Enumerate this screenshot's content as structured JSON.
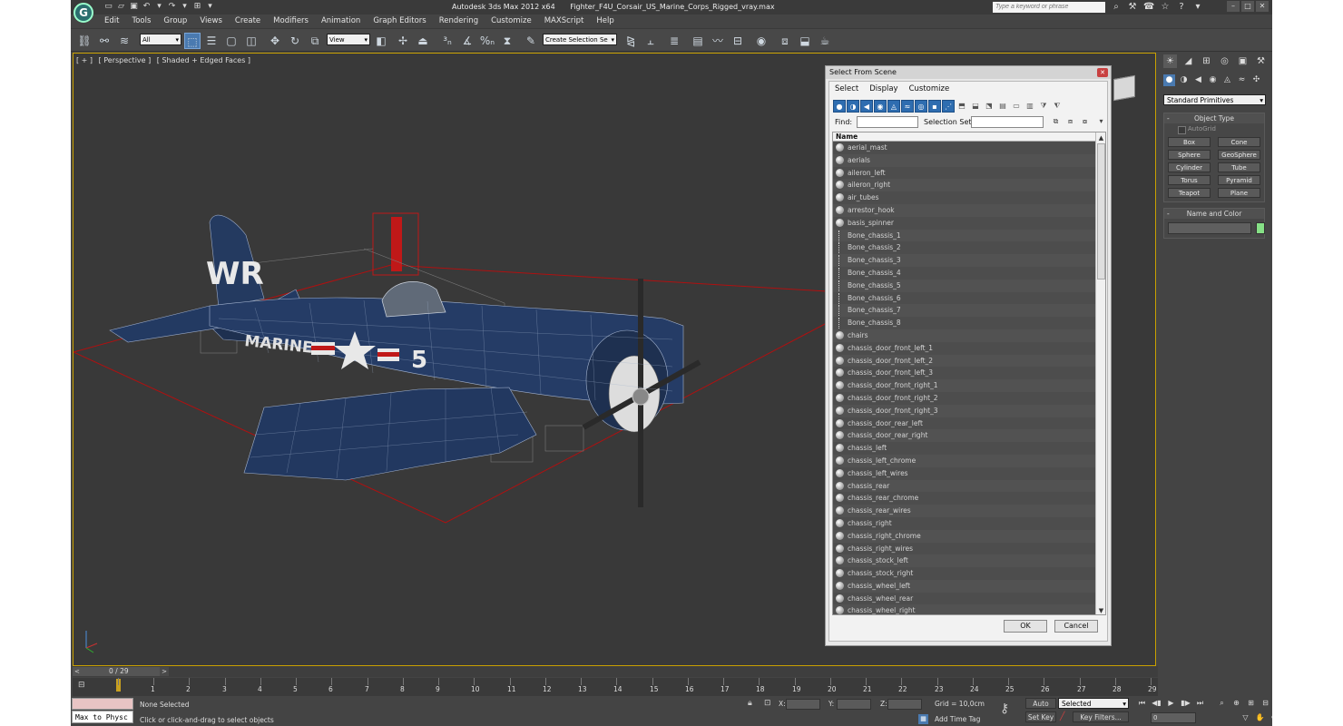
{
  "window": {
    "app_title": "Autodesk 3ds Max  2012 x64",
    "file_name": "Fighter_F4U_Corsair_US_Marine_Corps_Rigged_vray.max",
    "search_placeholder": "Type a keyword or phrase"
  },
  "menu": [
    "Edit",
    "Tools",
    "Group",
    "Views",
    "Create",
    "Modifiers",
    "Animation",
    "Graph Editors",
    "Rendering",
    "Customize",
    "MAXScript",
    "Help"
  ],
  "toolbar": {
    "selection_filter": "All",
    "reference_coord": "View",
    "named_selection_set": "Create Selection Se"
  },
  "viewport": {
    "labels": [
      "[ + ]",
      "[ Perspective ]",
      "[ Shaded + Edged Faces ]"
    ],
    "decal_text": [
      "WR",
      "MARINES",
      "5"
    ]
  },
  "command_panel": {
    "category": "Standard Primitives",
    "object_type_title": "Object Type",
    "autogrid_label": "AutoGrid",
    "primitives": [
      "Box",
      "Cone",
      "Sphere",
      "GeoSphere",
      "Cylinder",
      "Tube",
      "Torus",
      "Pyramid",
      "Teapot",
      "Plane"
    ],
    "name_color_title": "Name and Color",
    "object_color": "#86e086"
  },
  "dialog": {
    "title": "Select From Scene",
    "menu": [
      "Select",
      "Display",
      "Customize"
    ],
    "find_label": "Find:",
    "selection_set_label": "Selection Set:",
    "column_header": "Name",
    "items": [
      {
        "name": "aerial_mast",
        "kind": "geometry"
      },
      {
        "name": "aerials",
        "kind": "geometry"
      },
      {
        "name": "aileron_left",
        "kind": "geometry"
      },
      {
        "name": "aileron_right",
        "kind": "geometry"
      },
      {
        "name": "air_tubes",
        "kind": "geometry"
      },
      {
        "name": "arrestor_hook",
        "kind": "geometry"
      },
      {
        "name": "basis_spinner",
        "kind": "geometry"
      },
      {
        "name": "Bone_chassis_1",
        "kind": "bone"
      },
      {
        "name": "Bone_chassis_2",
        "kind": "bone"
      },
      {
        "name": "Bone_chassis_3",
        "kind": "bone"
      },
      {
        "name": "Bone_chassis_4",
        "kind": "bone"
      },
      {
        "name": "Bone_chassis_5",
        "kind": "bone"
      },
      {
        "name": "Bone_chassis_6",
        "kind": "bone"
      },
      {
        "name": "Bone_chassis_7",
        "kind": "bone"
      },
      {
        "name": "Bone_chassis_8",
        "kind": "bone"
      },
      {
        "name": "chairs",
        "kind": "geometry"
      },
      {
        "name": "chassis_door_front_left_1",
        "kind": "geometry"
      },
      {
        "name": "chassis_door_front_left_2",
        "kind": "geometry"
      },
      {
        "name": "chassis_door_front_left_3",
        "kind": "geometry"
      },
      {
        "name": "chassis_door_front_right_1",
        "kind": "geometry"
      },
      {
        "name": "chassis_door_front_right_2",
        "kind": "geometry"
      },
      {
        "name": "chassis_door_front_right_3",
        "kind": "geometry"
      },
      {
        "name": "chassis_door_rear_left",
        "kind": "geometry"
      },
      {
        "name": "chassis_door_rear_right",
        "kind": "geometry"
      },
      {
        "name": "chassis_left",
        "kind": "geometry"
      },
      {
        "name": "chassis_left_chrome",
        "kind": "geometry"
      },
      {
        "name": "chassis_left_wires",
        "kind": "geometry"
      },
      {
        "name": "chassis_rear",
        "kind": "geometry"
      },
      {
        "name": "chassis_rear_chrome",
        "kind": "geometry"
      },
      {
        "name": "chassis_rear_wires",
        "kind": "geometry"
      },
      {
        "name": "chassis_right",
        "kind": "geometry"
      },
      {
        "name": "chassis_right_chrome",
        "kind": "geometry"
      },
      {
        "name": "chassis_right_wires",
        "kind": "geometry"
      },
      {
        "name": "chassis_stock_left",
        "kind": "geometry"
      },
      {
        "name": "chassis_stock_right",
        "kind": "geometry"
      },
      {
        "name": "chassis_wheel_left",
        "kind": "geometry"
      },
      {
        "name": "chassis_wheel_rear",
        "kind": "geometry"
      },
      {
        "name": "chassis_wheel_right",
        "kind": "geometry"
      }
    ],
    "ok_label": "OK",
    "cancel_label": "Cancel"
  },
  "timeline": {
    "slider_label": "0 / 29",
    "frame_numbers": [
      "0",
      "1",
      "2",
      "3",
      "4",
      "5",
      "6",
      "7",
      "8",
      "9",
      "10",
      "11",
      "12",
      "13",
      "14",
      "15",
      "16",
      "17",
      "18",
      "19",
      "20",
      "21",
      "22",
      "23",
      "24",
      "25",
      "26",
      "27",
      "28",
      "29"
    ]
  },
  "status": {
    "maxscript_text": "Max to Physc",
    "selection_text": "None Selected",
    "prompt_text": "Click or click-and-drag to select objects",
    "x_label": "X:",
    "y_label": "Y:",
    "z_label": "Z:",
    "grid_text": "Grid = 10,0cm",
    "add_time_tag": "Add Time Tag",
    "auto_key": "Auto Key",
    "set_key": "Set Key",
    "key_mode": "Selected",
    "key_filters": "Key Filters...",
    "current_frame": "0"
  }
}
